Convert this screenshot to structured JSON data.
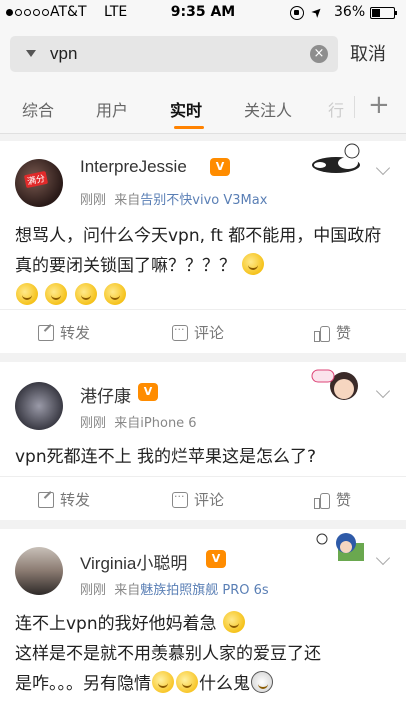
{
  "status_bar": {
    "carrier": "AT&T",
    "network": "LTE",
    "time": "9:35 AM",
    "battery": "36%",
    "signal_bars_filled": 1,
    "signal_bars_total": 5
  },
  "search": {
    "query": "vpn",
    "cancel_label": "取消"
  },
  "tabs": [
    {
      "label": "综合",
      "active": false
    },
    {
      "label": "用户",
      "active": false
    },
    {
      "label": "实时",
      "active": true
    },
    {
      "label": "关注人",
      "active": false
    },
    {
      "label": "行",
      "active": false
    }
  ],
  "accent_color": "#ff8200",
  "posts": [
    {
      "user": "InterpreJessie",
      "avatar_badge": "满分",
      "time": "刚刚",
      "source_prefix": "来自",
      "source": "告别不快vivo V3Max",
      "text": "想骂人，问什么今天vpn, ft 都不能用，中国政府真的要闭关锁国了嘛？？？？",
      "emoji_count": 5,
      "actions": {
        "share": "转发",
        "comment": "评论",
        "like": "赞"
      }
    },
    {
      "user": "港仔康",
      "time": "刚刚",
      "source_prefix": "来自",
      "source": "iPhone 6",
      "text": "vpn死都连不上 我的烂苹果这是怎么了?",
      "actions": {
        "share": "转发",
        "comment": "评论",
        "like": "赞"
      }
    },
    {
      "user": "Virginia小聪明",
      "time": "刚刚",
      "source_prefix": "来自",
      "source": "魅族拍照旗舰 PRO 6s",
      "text_line1": "连不上vpn的我好他妈着急",
      "text_line2": "这样是不是就不用羡慕别人家的爱豆了还",
      "text_line3": "是咋。。。另有隐情",
      "text_line3b": "什么鬼"
    }
  ]
}
